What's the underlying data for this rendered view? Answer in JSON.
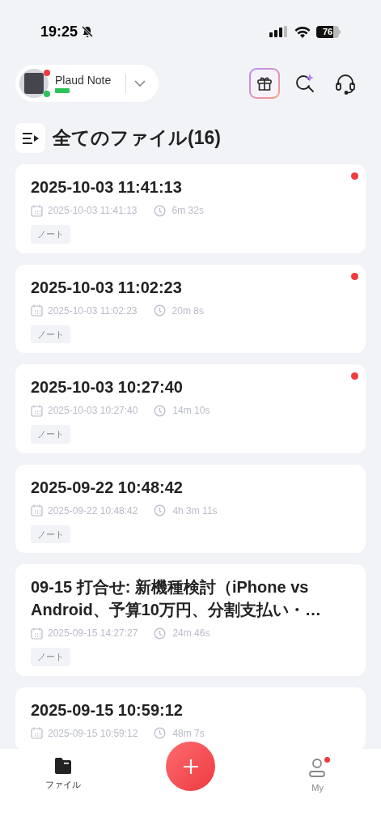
{
  "status_bar": {
    "time": "19:25",
    "battery": "76"
  },
  "device": {
    "name": "Plaud Note"
  },
  "section": {
    "title": "全てのファイル(16)"
  },
  "files": [
    {
      "title": "2025-10-03 11:41:13",
      "date": "2025-10-03 11:41:13",
      "duration": "6m 32s",
      "tag": "ノート",
      "unread": true
    },
    {
      "title": "2025-10-03 11:02:23",
      "date": "2025-10-03 11:02:23",
      "duration": "20m 8s",
      "tag": "ノート",
      "unread": true
    },
    {
      "title": "2025-10-03 10:27:40",
      "date": "2025-10-03 10:27:40",
      "duration": "14m 10s",
      "tag": "ノート",
      "unread": true
    },
    {
      "title": "2025-09-22 10:48:42",
      "date": "2025-09-22 10:48:42",
      "duration": "4h 3m 11s",
      "tag": "ノート",
      "unread": false
    },
    {
      "title": "09-15 打合せ: 新機種検討（iPhone vs Android、予算10万円、分割支払い・…",
      "date": "2025-09-15 14:27:27",
      "duration": "24m 46s",
      "tag": "ノート",
      "unread": false
    },
    {
      "title": "2025-09-15 10:59:12",
      "date": "2025-09-15 10:59:12",
      "duration": "48m 7s",
      "unread": false
    }
  ],
  "tab_bar": [
    {
      "label": "ファイル",
      "selected": true,
      "badge": false
    },
    {
      "label": "My",
      "selected": false,
      "badge": true
    }
  ]
}
